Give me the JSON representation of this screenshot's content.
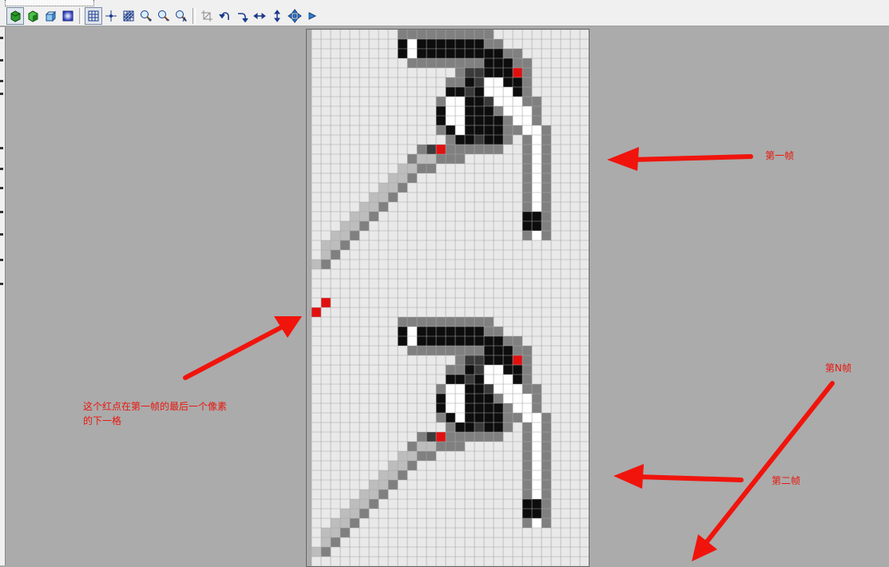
{
  "toolbar": {
    "icons": [
      "green-cube-icon",
      "green-cube-shaded-icon",
      "blue-cube-icon",
      "gradient-box-icon",
      "grid-icon",
      "crosshair-icon",
      "hatch-grid-icon",
      "zoom-in-icon",
      "zoom-out-icon",
      "zoom-text-icon",
      "crop-icon",
      "rotate-left-icon",
      "rotate-right-icon",
      "flip-horizontal-icon",
      "flip-vertical-icon",
      "move-all-icon",
      "move-right-icon"
    ]
  },
  "colors": {
    "background": "#ababab",
    "grid_bg": "#e9e9e9",
    "grid_line": "#a6a6a6",
    "annotation": "#e8170e"
  },
  "annotations": {
    "frame1": "第一帧",
    "frame2": "第二帧",
    "frameN": "第N帧",
    "red_dot_line1": "这个红点在第一帧的最后一个像素",
    "red_dot_line2": "的下一格"
  }
}
